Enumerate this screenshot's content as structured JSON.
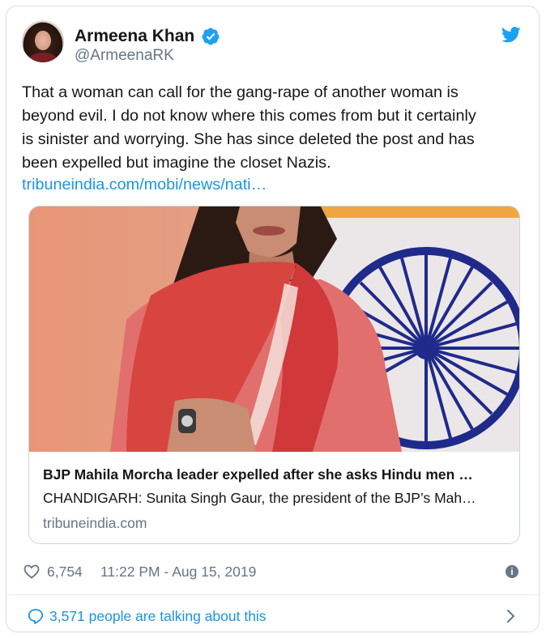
{
  "author": {
    "name": "Armeena Khan",
    "handle": "@ArmeenaRK"
  },
  "tweet": {
    "lines": [
      "That a woman can call for the gang-rape of another woman is",
      "beyond evil. I do not know where this comes from but it certainly",
      "is sinister and worrying. She has since deleted the post and has",
      "been expelled but imagine the closet Nazis."
    ],
    "link": "tribuneindia.com/mobi/news/nati…"
  },
  "link_card": {
    "title": "BJP Mahila Morcha leader expelled after she asks Hindu men …",
    "description": "CHANDIGARH: Sunita Singh Gaur, the president of the BJP’s Mah…",
    "domain": "tribuneindia.com"
  },
  "stats": {
    "likes": "6,754",
    "timestamp": "11:22 PM - Aug 15, 2019",
    "talking": "3,571 people are talking about this"
  },
  "icons": {
    "verified": "verified-badge-icon",
    "brand": "twitter-bird-icon",
    "like": "heart-icon",
    "info": "info-icon",
    "talk": "speech-bubble-icon",
    "more": "chevron-right-icon"
  },
  "colors": {
    "link": "#1b95e0",
    "secondary_text": "#657786",
    "verified": "#1da1f2",
    "border": "#ccd6dd"
  }
}
